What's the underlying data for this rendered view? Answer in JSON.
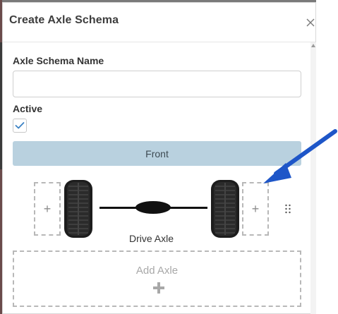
{
  "modal": {
    "title": "Create Axle Schema",
    "close_icon": "close-icon"
  },
  "form": {
    "name_label": "Axle Schema Name",
    "name_value": "",
    "name_placeholder": "",
    "active_label": "Active",
    "active_checked": true
  },
  "front_button": {
    "label": "Front",
    "color": "#b9d1df"
  },
  "axle": {
    "label": "Drive Axle",
    "left_slot_icon": "plus-icon",
    "right_slot_icon": "plus-icon",
    "left_slot_text": "+",
    "right_slot_text": "+",
    "drag_icon": "drag-handle-icon"
  },
  "add_axle": {
    "label": "Add Axle",
    "icon": "plus-icon"
  },
  "annotation": {
    "arrow_color": "#1e56c8",
    "icon": "arrow-icon"
  },
  "colors": {
    "accent_blue": "#b9d1df",
    "checkbox_check": "#3b82c4"
  }
}
